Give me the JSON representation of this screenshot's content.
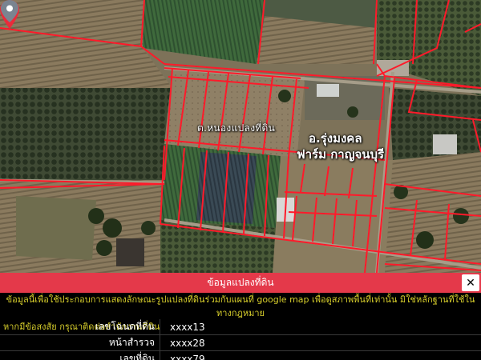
{
  "map": {
    "parcel_label": "ต.หนองแปลงที่ดิน",
    "farm_label_line1": "อ.รุ่งมงคล",
    "farm_label_line2": "ฟาร์ม กาญจนบุรี",
    "icons": [
      "map-pin-icon",
      "location-pin-icon"
    ],
    "colors": {
      "parcel_border": "#ff1a2a",
      "pin": "#ea2b3a"
    }
  },
  "panel": {
    "title": "ข้อมูลแปลงที่ดิน",
    "close_label": "✕",
    "notice_line1": "ข้อมูลนี้เพื่อใช้ประกอบการแสดงลักษณะรูปแปลงที่ดินร่วมกับแผนที่ google map เพื่อดูสภาพพื้นที่เท่านั้น มิใช่หลักฐานที่ใช้ในทางกฎหมาย",
    "notice_line2": "หากมีข้อสงสัย กรุณาติดต่อสำนักงานที่ดิน",
    "rows": [
      {
        "label": "เลขโฉนดที่ดิน",
        "value": "xxxx13"
      },
      {
        "label": "หน้าสำรวจ",
        "value": "xxxx28"
      },
      {
        "label": "เลขที่ดิน",
        "value": "xxxx79"
      }
    ],
    "colors": {
      "header_bg": "#e4394a",
      "notice_text": "#d8cf2c"
    }
  }
}
